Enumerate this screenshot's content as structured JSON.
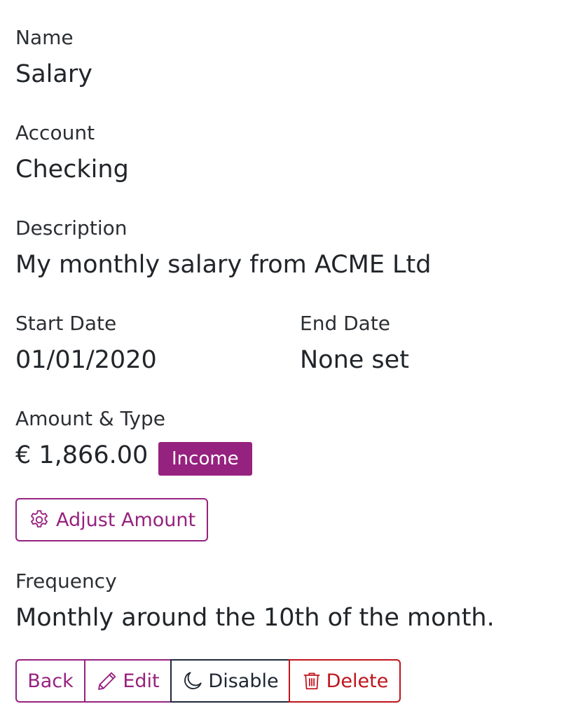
{
  "fields": {
    "name": {
      "label": "Name",
      "value": "Salary"
    },
    "account": {
      "label": "Account",
      "value": "Checking"
    },
    "description": {
      "label": "Description",
      "value": "My monthly salary from ACME Ltd"
    },
    "start_date": {
      "label": "Start Date",
      "value": "01/01/2020"
    },
    "end_date": {
      "label": "End Date",
      "value": "None set"
    },
    "amount": {
      "label": "Amount & Type",
      "value": "€ 1,866.00",
      "type_badge": "Income"
    },
    "frequency": {
      "label": "Frequency",
      "value": "Monthly around the 10th of the month."
    }
  },
  "actions": {
    "adjust_amount": {
      "label": "Adjust Amount",
      "icon": "gear-icon"
    },
    "back": {
      "label": "Back"
    },
    "edit": {
      "label": "Edit",
      "icon": "pencil-icon"
    },
    "disable": {
      "label": "Disable",
      "icon": "moon-icon"
    },
    "delete": {
      "label": "Delete",
      "icon": "trash-icon"
    }
  },
  "colors": {
    "accent": "#96227f",
    "danger": "#c0141c",
    "dark": "#1e2a3a",
    "text": "#212529"
  }
}
